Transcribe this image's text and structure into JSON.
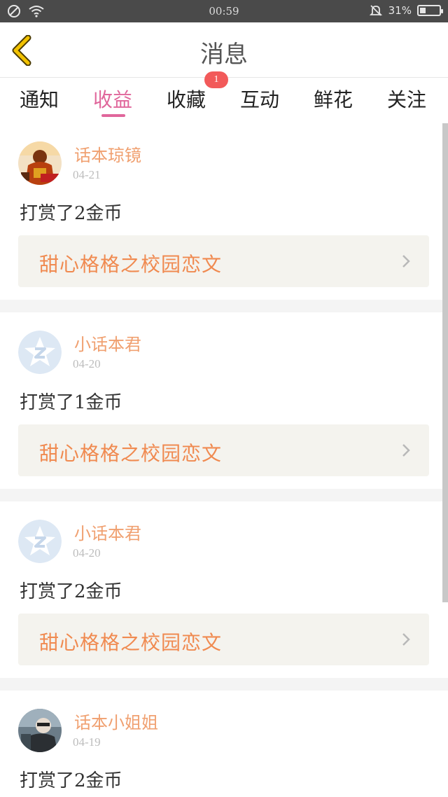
{
  "status_bar": {
    "time": "00:59",
    "battery": "31%",
    "battery_level": 0.31,
    "icons": [
      "blocked-icon",
      "wifi-icon",
      "mute-bell-icon",
      "battery-icon"
    ]
  },
  "header": {
    "title": "消息",
    "back_icon": "chevron-left-icon"
  },
  "tabs": [
    {
      "label": "通知",
      "active": false
    },
    {
      "label": "收益",
      "active": true
    },
    {
      "label": "收藏",
      "active": false,
      "badge": "1"
    },
    {
      "label": "互动",
      "active": false
    },
    {
      "label": "鲜花",
      "active": false
    },
    {
      "label": "关注",
      "active": false
    }
  ],
  "messages": [
    {
      "name": "话本琼镜",
      "date": "04-21",
      "text": "打赏了2金币",
      "link": "甜心格格之校园恋文"
    },
    {
      "name": "小话本君",
      "date": "04-20",
      "text": "打赏了1金币",
      "link": "甜心格格之校园恋文"
    },
    {
      "name": "小话本君",
      "date": "04-20",
      "text": "打赏了2金币",
      "link": "甜心格格之校园恋文"
    },
    {
      "name": "话本小姐姐",
      "date": "04-19",
      "text": "打赏了2金币",
      "link": ""
    }
  ],
  "colors": {
    "accent": "#e0669b",
    "name": "#f0a070",
    "link": "#f08a50",
    "badge": "#f25a5a",
    "back_arrow": "#f2c200"
  }
}
